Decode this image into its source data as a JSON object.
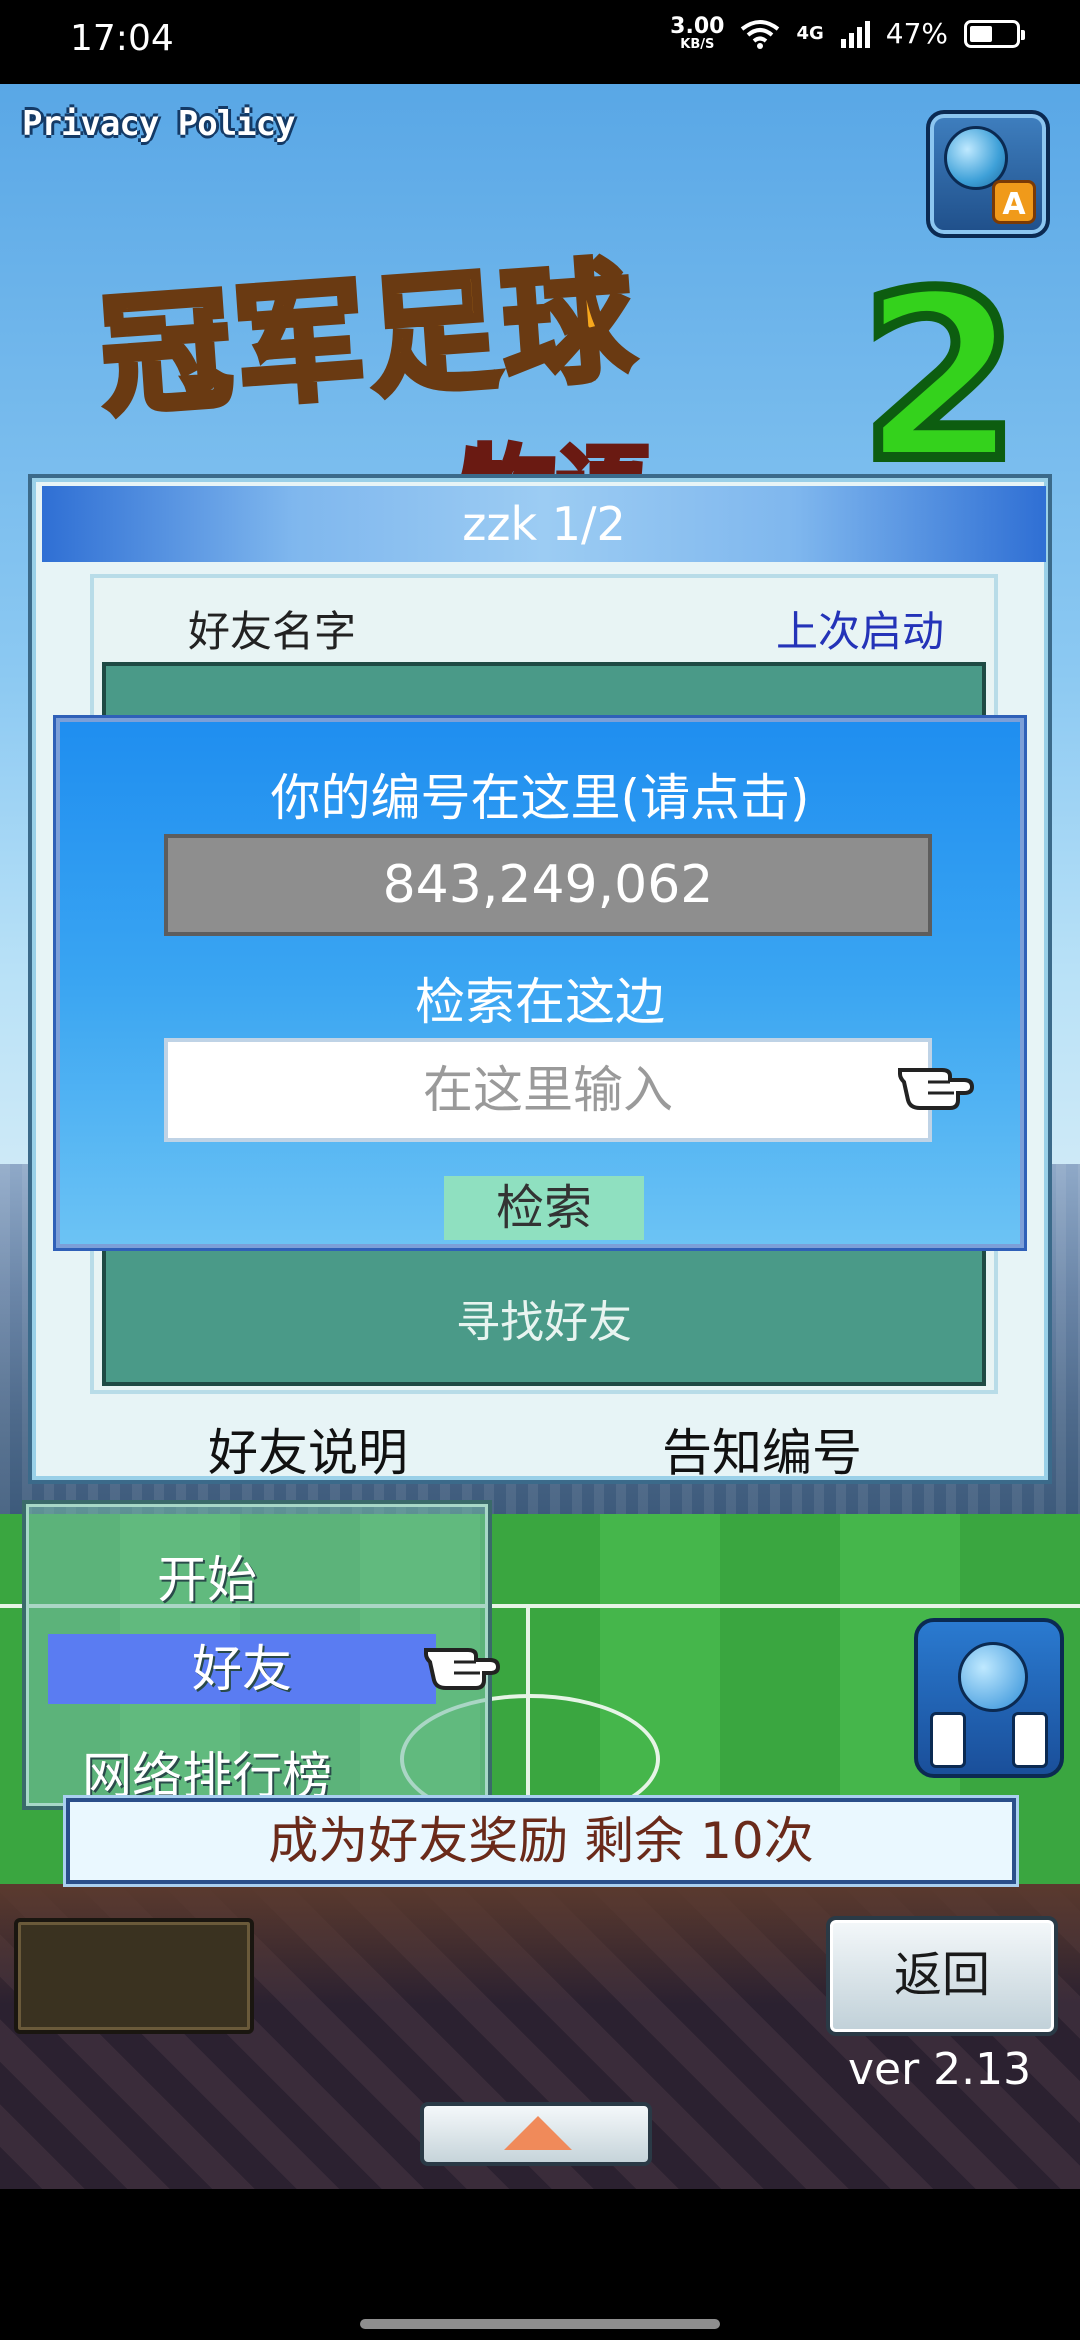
{
  "status_bar": {
    "time": "17:04",
    "net_speed_value": "3.00",
    "net_speed_unit": "KB/S",
    "network": "4G",
    "battery": "47%"
  },
  "header": {
    "privacy_label": "Privacy Policy",
    "logo_title": "冠军足球",
    "logo_subtitle": "物语",
    "logo_number": "2"
  },
  "panel": {
    "title": "zzk 1/2",
    "col_name": "好友名字",
    "col_last": "上次启动",
    "find_friend": "寻找好友",
    "btn_explain": "好友说明",
    "btn_notify_id": "告知编号"
  },
  "dialog": {
    "id_label": "你的编号在这里(请点击)",
    "id_value": "843,249,062",
    "search_label": "检索在这边",
    "search_placeholder": "在这里输入",
    "search_button": "检索"
  },
  "menu": {
    "items": [
      "开始",
      "好友",
      "网络排行榜"
    ],
    "selected": "好友"
  },
  "reward_banner": "成为好友奖励 剩余 10次",
  "bottom": {
    "back_label": "返回",
    "version": "ver 2.13"
  },
  "colors": {
    "dialog_blue": "#1f8ef0",
    "menu_highlight": "#5a7cf2",
    "list_green": "#4a9a88",
    "last_launch_text": "#2433b8"
  }
}
